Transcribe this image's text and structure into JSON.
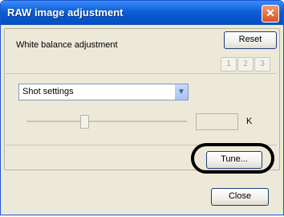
{
  "window": {
    "title": "RAW image adjustment",
    "close_icon": "close-icon"
  },
  "white_balance": {
    "label": "White balance adjustment",
    "reset_label": "Reset",
    "slots": [
      "1",
      "2",
      "3"
    ],
    "preset": {
      "selected": "Shot settings"
    },
    "kelvin": {
      "value": "",
      "unit": "K"
    },
    "tune_label": "Tune..."
  },
  "footer": {
    "close_label": "Close"
  }
}
